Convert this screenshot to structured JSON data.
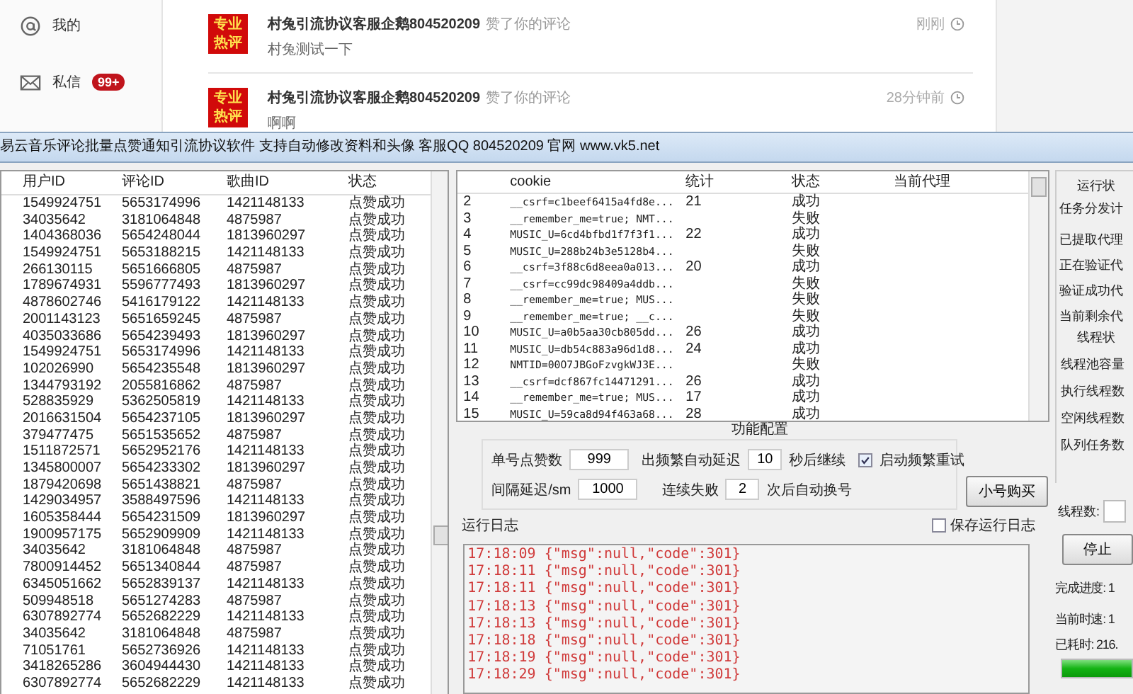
{
  "web_sidebar": [
    {
      "kind": "at",
      "label": "我的"
    },
    {
      "kind": "mail",
      "label": "私信",
      "badge": "99+"
    }
  ],
  "notifications": [
    {
      "badge": "专业热评",
      "user": "村兔引流协议客服企鹅804520209",
      "action": "赞了你的评论",
      "time": "刚刚",
      "text": "村兔测试一下"
    },
    {
      "badge": "专业热评",
      "user": "村兔引流协议客服企鹅804520209",
      "action": "赞了你的评论",
      "time": "28分钟前",
      "text": "啊啊"
    }
  ],
  "window": {
    "title": "易云音乐评论批量点赞通知引流协议软件  支持自动修改资料和头像 客服QQ 804520209 官网 www.vk5.net"
  },
  "likes_table": {
    "columns": [
      "用户ID",
      "评论ID",
      "歌曲ID",
      "状态"
    ],
    "rows": [
      [
        "1549924751",
        "5653174996",
        "1421148133",
        "点赞成功"
      ],
      [
        "34035642",
        "3181064848",
        "4875987",
        "点赞成功"
      ],
      [
        "1404368036",
        "5654248044",
        "1813960297",
        "点赞成功"
      ],
      [
        "1549924751",
        "5653188215",
        "1421148133",
        "点赞成功"
      ],
      [
        "266130115",
        "5651666805",
        "4875987",
        "点赞成功"
      ],
      [
        "1789674931",
        "5596777493",
        "1813960297",
        "点赞成功"
      ],
      [
        "4878602746",
        "5416179122",
        "1421148133",
        "点赞成功"
      ],
      [
        "2001143123",
        "5651659245",
        "4875987",
        "点赞成功"
      ],
      [
        "4035033686",
        "5654239493",
        "1813960297",
        "点赞成功"
      ],
      [
        "1549924751",
        "5653174996",
        "1421148133",
        "点赞成功"
      ],
      [
        "102026990",
        "5654235548",
        "1813960297",
        "点赞成功"
      ],
      [
        "1344793192",
        "2055816862",
        "4875987",
        "点赞成功"
      ],
      [
        "528835929",
        "5362505819",
        "1421148133",
        "点赞成功"
      ],
      [
        "2016631504",
        "5654237105",
        "1813960297",
        "点赞成功"
      ],
      [
        "379477475",
        "5651535652",
        "4875987",
        "点赞成功"
      ],
      [
        "1511872571",
        "5652952176",
        "1421148133",
        "点赞成功"
      ],
      [
        "1345800007",
        "5654233302",
        "1813960297",
        "点赞成功"
      ],
      [
        "1879420698",
        "5651438821",
        "4875987",
        "点赞成功"
      ],
      [
        "1429034957",
        "3588497596",
        "1421148133",
        "点赞成功"
      ],
      [
        "1605358444",
        "5654231509",
        "1813960297",
        "点赞成功"
      ],
      [
        "1900957175",
        "5652909909",
        "1421148133",
        "点赞成功"
      ],
      [
        "34035642",
        "3181064848",
        "4875987",
        "点赞成功"
      ],
      [
        "7800914452",
        "5651340844",
        "4875987",
        "点赞成功"
      ],
      [
        "6345051662",
        "5652839137",
        "1421148133",
        "点赞成功"
      ],
      [
        "509948518",
        "5651274283",
        "4875987",
        "点赞成功"
      ],
      [
        "6307892774",
        "5652682229",
        "1421148133",
        "点赞成功"
      ],
      [
        "34035642",
        "3181064848",
        "4875987",
        "点赞成功"
      ],
      [
        "71051761",
        "5652736926",
        "1421148133",
        "点赞成功"
      ],
      [
        "3418265286",
        "3604944430",
        "1421148133",
        "点赞成功"
      ],
      [
        "6307892774",
        "5652682229",
        "1421148133",
        "点赞成功"
      ]
    ]
  },
  "cookie_table": {
    "columns": [
      "cookie",
      "统计",
      "状态",
      "当前代理"
    ],
    "rows": [
      {
        "no": "2",
        "cookie": "__csrf=c1beef6415a4fd8e...",
        "count": "21",
        "status": "成功"
      },
      {
        "no": "3",
        "cookie": "__remember_me=true; NMT...",
        "status": "失败"
      },
      {
        "no": "4",
        "cookie": "MUSIC_U=6cd4bfbd1f7f3f1...",
        "count": "22",
        "status": "成功"
      },
      {
        "no": "5",
        "cookie": "MUSIC_U=288b24b3e5128b4...",
        "status": "失败"
      },
      {
        "no": "6",
        "cookie": "__csrf=3f88c6d8eea0a013...",
        "count": "20",
        "status": "成功"
      },
      {
        "no": "7",
        "cookie": "__csrf=cc99dc98409a4ddb...",
        "status": "失败"
      },
      {
        "no": "8",
        "cookie": "__remember_me=true; MUS...",
        "status": "失败"
      },
      {
        "no": "9",
        "cookie": "__remember_me=true; __c...",
        "status": "失败"
      },
      {
        "no": "10",
        "cookie": "MUSIC_U=a0b5aa30cb805dd...",
        "count": "26",
        "status": "成功"
      },
      {
        "no": "11",
        "cookie": "MUSIC_U=db54c883a96d1d8...",
        "count": "24",
        "status": "成功"
      },
      {
        "no": "12",
        "cookie": "NMTID=00O7JBGoFzvgkWJ3E...",
        "status": "失败"
      },
      {
        "no": "13",
        "cookie": "__csrf=dcf867fc14471291...",
        "count": "26",
        "status": "成功"
      },
      {
        "no": "14",
        "cookie": "__remember_me=true; MUS...",
        "count": "17",
        "status": "成功"
      },
      {
        "no": "15",
        "cookie": "MUSIC_U=59ca8d94f463a68...",
        "count": "28",
        "status": "成功"
      }
    ]
  },
  "config": {
    "title": "功能配置",
    "likes_per_account": {
      "label": "单号点赞数",
      "value": "999"
    },
    "frequent_delay": {
      "label": "出频繁自动延迟",
      "value": "10",
      "suffix": "秒后继续"
    },
    "retry": {
      "label": "启动频繁重试",
      "checked": true
    },
    "interval": {
      "label": "间隔延迟/sm",
      "value": "1000"
    },
    "fail_switch": {
      "label": "连续失败",
      "value": "2",
      "suffix": "次后自动换号"
    },
    "buy_button": "小号购买"
  },
  "log": {
    "title": "运行日志",
    "save": {
      "label": "保存运行日志",
      "checked": false
    },
    "lines": [
      "17:18:09 {\"msg\":null,\"code\":301}",
      "17:18:11 {\"msg\":null,\"code\":301}",
      "17:18:11 {\"msg\":null,\"code\":301}",
      "17:18:13 {\"msg\":null,\"code\":301}",
      "17:18:13 {\"msg\":null,\"code\":301}",
      "17:18:18 {\"msg\":null,\"code\":301}",
      "17:18:19 {\"msg\":null,\"code\":301}",
      "17:18:29 {\"msg\":null,\"code\":301}"
    ]
  },
  "status_panel": {
    "title": "运行状",
    "items": [
      "任务分发计",
      "已提取代理",
      "正在验证代",
      "验证成功代",
      "当前剩余代"
    ],
    "thread_title": "线程状",
    "thread_items": [
      "线程池容量",
      "执行线程数",
      "空闲线程数",
      "队列任务数"
    ],
    "thread_count_label": "线程数:",
    "stop_button": "停止",
    "progress_label": "完成进度: 1",
    "speed_label": "当前时速: 1",
    "elapsed_label": "已耗时: 216.",
    "progress": {
      "level": 1
    }
  }
}
